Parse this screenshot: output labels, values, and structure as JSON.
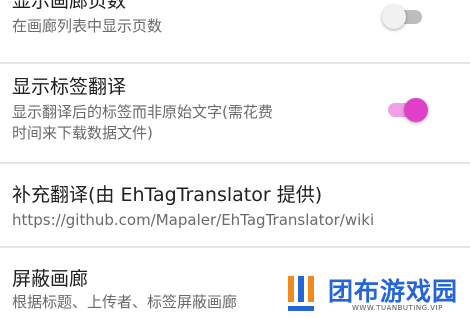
{
  "settings": {
    "show_pages": {
      "title": "显示画廊页数",
      "summary": "在画廊列表中显示页数",
      "enabled": false
    },
    "show_tag_translation": {
      "title": "显示标签翻译",
      "summary_line1": "显示翻译后的标签而非原始文字(需花费",
      "summary_line2": "时间来下载数据文件)",
      "enabled": true
    },
    "extra_translation": {
      "title": "补充翻译(由 EhTagTranslator 提供)",
      "summary": "https://github.com/Mapaler/EhTagTranslator/wiki"
    },
    "block_gallery": {
      "title": "屏蔽画廊",
      "summary": "根据标题、上传者、标签屏蔽画廊"
    }
  },
  "watermark": {
    "name": "团布游戏园",
    "url": "WWW.TUANBUTING.VIP"
  },
  "colors": {
    "accent": "#e040c8",
    "accent_track": "#f0a0e6",
    "watermark_blue": "#2466d6",
    "watermark_orange": "#f08a1c"
  }
}
